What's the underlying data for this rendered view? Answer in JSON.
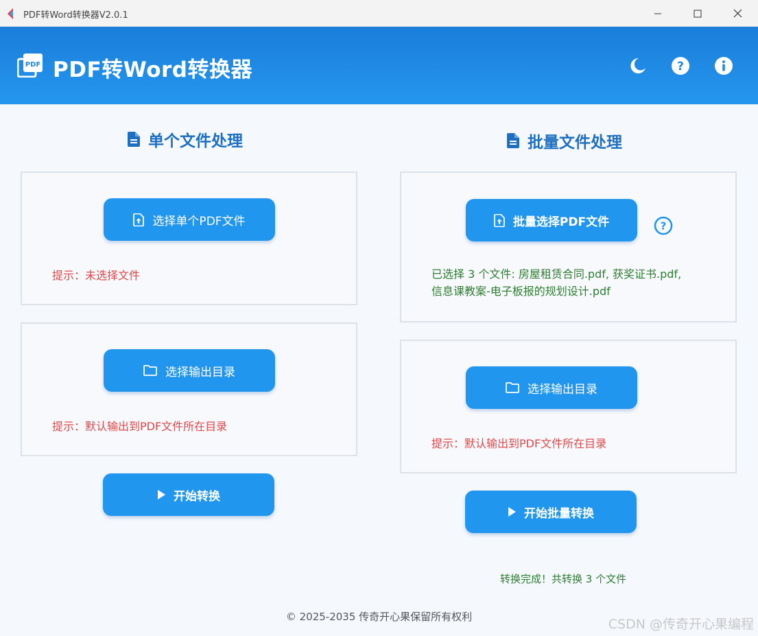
{
  "window": {
    "title": "PDF转Word转换器V2.0.1"
  },
  "header": {
    "title": "PDF转Word转换器",
    "icons": [
      "moon-icon",
      "help-icon",
      "info-icon"
    ]
  },
  "single": {
    "heading": "单个文件处理",
    "select_button": "选择单个PDF文件",
    "select_hint": "提示：未选择文件",
    "output_button": "选择输出目录",
    "output_hint": "提示：默认输出到PDF文件所在目录",
    "start_button": "开始转换"
  },
  "batch": {
    "heading": "批量文件处理",
    "select_button": "批量选择PDF文件",
    "selected_line1": "已选择 3 个文件: 房屋租赁合同.pdf, 获奖证书.pdf,",
    "selected_line2": "信息课教案-电子板报的规划设计.pdf",
    "output_button": "选择输出目录",
    "output_hint": "提示：默认输出到PDF文件所在目录",
    "start_button": "开始批量转换",
    "status": "转换完成！共转换 3 个文件"
  },
  "footer": {
    "copyright": "© 2025-2035 传奇开心果保留所有权利"
  },
  "watermark": "CSDN @传奇开心果编程",
  "colors": {
    "primary": "#2196ee",
    "header": "#1a7ed9",
    "heading": "#1e6fc0",
    "hint_red": "#e04848",
    "success_green": "#2f7d32"
  }
}
